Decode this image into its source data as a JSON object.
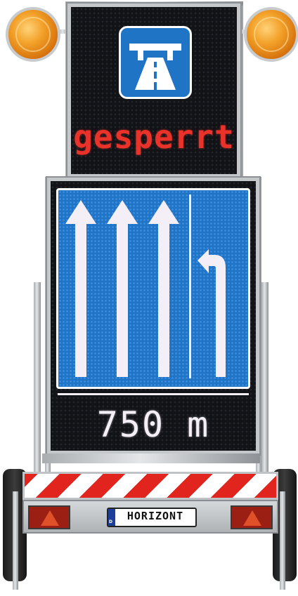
{
  "top_panel": {
    "pictogram": "autobahn-icon",
    "text": "gesperrt",
    "text_color": "#e8322a"
  },
  "lane_panel": {
    "arrows": [
      {
        "direction": "straight",
        "icon": "arrow-up-icon"
      },
      {
        "direction": "straight",
        "icon": "arrow-up-icon"
      },
      {
        "direction": "straight",
        "icon": "arrow-up-icon"
      },
      {
        "direction": "merge-left",
        "icon": "arrow-curve-left-icon"
      }
    ],
    "distance": "750 m",
    "sign_color": "#1f74c6"
  },
  "trailer": {
    "plate_text": "HORIZONT",
    "plate_country": "D"
  },
  "lamps": {
    "color": "#f3a22a"
  }
}
